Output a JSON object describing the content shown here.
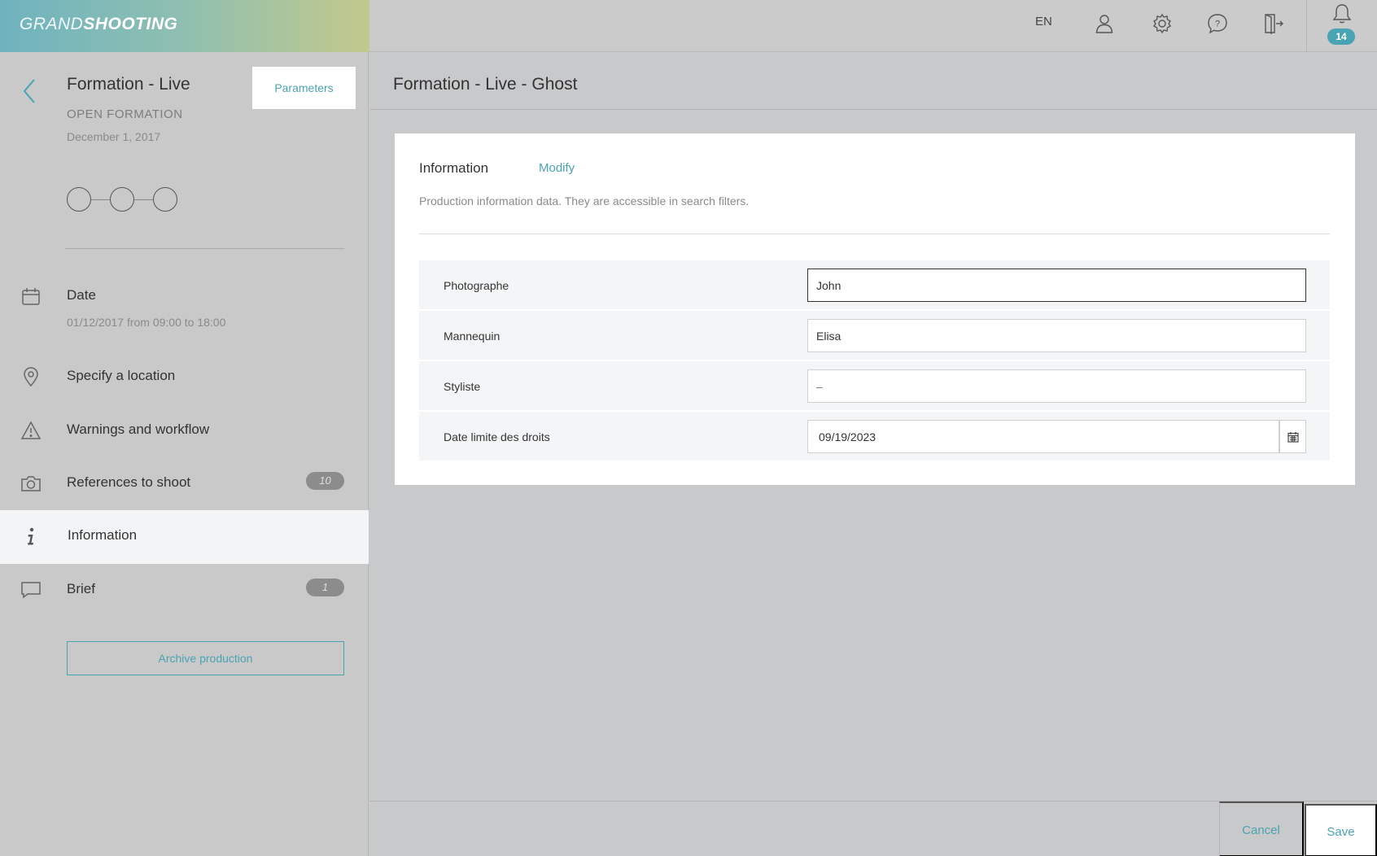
{
  "topbar": {
    "logo_thin": "GRAND",
    "logo_bold": "SHOOTING",
    "language": "EN",
    "notifications_count": "14",
    "icons": [
      "user-icon",
      "gear-icon",
      "help-icon",
      "logout-icon",
      "bell-icon"
    ]
  },
  "sidebar": {
    "title": "Formation - Live",
    "subtitle": "OPEN FORMATION",
    "date": "December 1, 2017",
    "parameters_label": "Parameters",
    "items": [
      {
        "label": "Date",
        "sub": "01/12/2017 from 09:00 to 18:00",
        "icon": "calendar-icon"
      },
      {
        "label": "Specify a location",
        "icon": "location-pin-icon"
      },
      {
        "label": "Warnings and workflow",
        "icon": "warning-icon"
      },
      {
        "label": "References to shoot",
        "badge": "10",
        "icon": "camera-icon"
      },
      {
        "label": "Information",
        "icon": "info-icon",
        "active": true
      },
      {
        "label": "Brief",
        "badge": "1",
        "icon": "comment-icon"
      }
    ],
    "archive_label": "Archive production"
  },
  "main": {
    "title": "Formation - Live - Ghost",
    "card": {
      "title": "Information",
      "modify_label": "Modify",
      "description": "Production information data. They are accessible in search filters.",
      "fields": [
        {
          "label": "Photographe",
          "value": "John"
        },
        {
          "label": "Mannequin",
          "value": "Elisa"
        },
        {
          "label": "Styliste",
          "placeholder": "–"
        },
        {
          "label": "Date limite des droits",
          "value": "09/19/2023"
        }
      ]
    }
  },
  "footer": {
    "cancel_label": "Cancel",
    "save_label": "Save"
  },
  "colors": {
    "accent": "#4aa3b3",
    "background": "#c8c9cb"
  }
}
